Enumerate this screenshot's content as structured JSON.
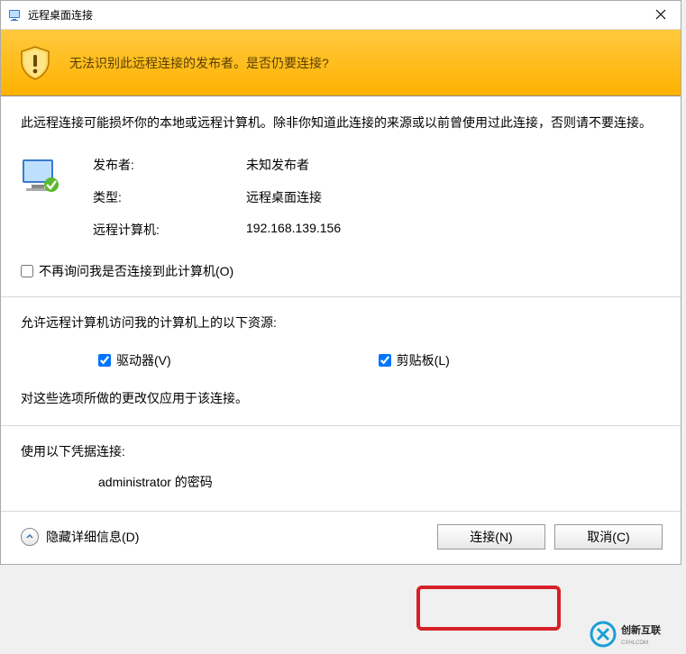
{
  "titlebar": {
    "title": "远程桌面连接"
  },
  "header": {
    "message": "无法识别此远程连接的发布者。是否仍要连接?"
  },
  "body": {
    "description": "此远程连接可能损坏你的本地或远程计算机。除非你知道此连接的来源或以前曾使用过此连接，否则请不要连接。",
    "publisher_label": "发布者:",
    "publisher_value": "未知发布者",
    "type_label": "类型:",
    "type_value": "远程桌面连接",
    "remote_computer_label": "远程计算机:",
    "remote_computer_value": "192.168.139.156",
    "dont_ask_label": "不再询问我是否连接到此计算机(O)"
  },
  "resources": {
    "heading": "允许远程计算机访问我的计算机上的以下资源:",
    "drives_label": "驱动器(V)",
    "clipboard_label": "剪贴板(L)",
    "note": "对这些选项所做的更改仅应用于该连接。"
  },
  "creds": {
    "heading": "使用以下凭据连接:",
    "value": "administrator 的密码"
  },
  "footer": {
    "disclosure_label": "隐藏详细信息(D)",
    "connect_label": "连接(N)",
    "cancel_label": "取消(C)"
  },
  "watermark": "创新互联"
}
